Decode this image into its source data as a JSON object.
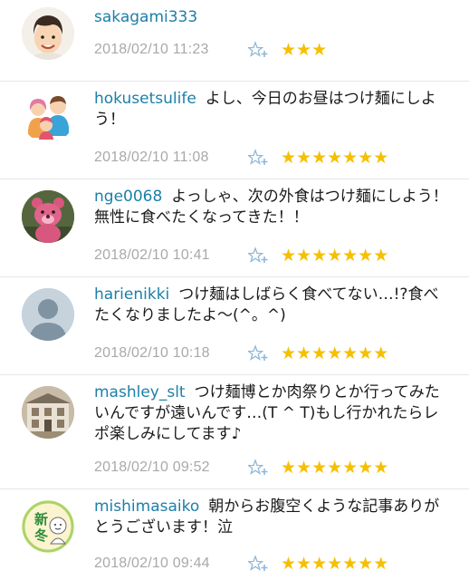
{
  "colors": {
    "username": "#1c7fa8",
    "timestamp": "#a9a9a9",
    "star": "#f5c000",
    "add_star_icon": "#8fb8d8"
  },
  "comments": [
    {
      "username": "sakagami333",
      "text": "",
      "timestamp": "2018/02/10 11:23",
      "stars": "★★★",
      "star_count": 3,
      "avatar": "man-face-avatar"
    },
    {
      "username": "hokusetsulife",
      "text": "よし、今日のお昼はつけ麺にしよう！",
      "timestamp": "2018/02/10 11:08",
      "stars": "★★★★★★★",
      "star_count": 7,
      "avatar": "family-avatar"
    },
    {
      "username": "nge0068",
      "text": "よっしゃ、次の外食はつけ麺にしよう！無性に食べたくなってきた！！",
      "timestamp": "2018/02/10 10:41",
      "stars": "★★★★★★★",
      "star_count": 7,
      "avatar": "bear-plush-avatar"
    },
    {
      "username": "harienikki",
      "text": "つけ麺はしばらく食べてない…!?食べたくなりましたよ〜(^。^)",
      "timestamp": "2018/02/10 10:18",
      "stars": "★★★★★★★",
      "star_count": 7,
      "avatar": "default-user-avatar"
    },
    {
      "username": "mashley_slt",
      "text": "つけ麺博とか肉祭りとか行ってみたいんですが遠いんです…(T ^ T)もし行かれたらレポ楽しみにしてます♪",
      "timestamp": "2018/02/10 09:52",
      "stars": "★★★★★★★",
      "star_count": 7,
      "avatar": "building-avatar"
    },
    {
      "username": "mishimasaiko",
      "text": "朝からお腹空くような記事ありがとうございます！泣",
      "timestamp": "2018/02/10 09:44",
      "stars": "★★★★★★★",
      "star_count": 7,
      "avatar": "new-winter-avatar",
      "avatar_text": "新冬"
    }
  ]
}
